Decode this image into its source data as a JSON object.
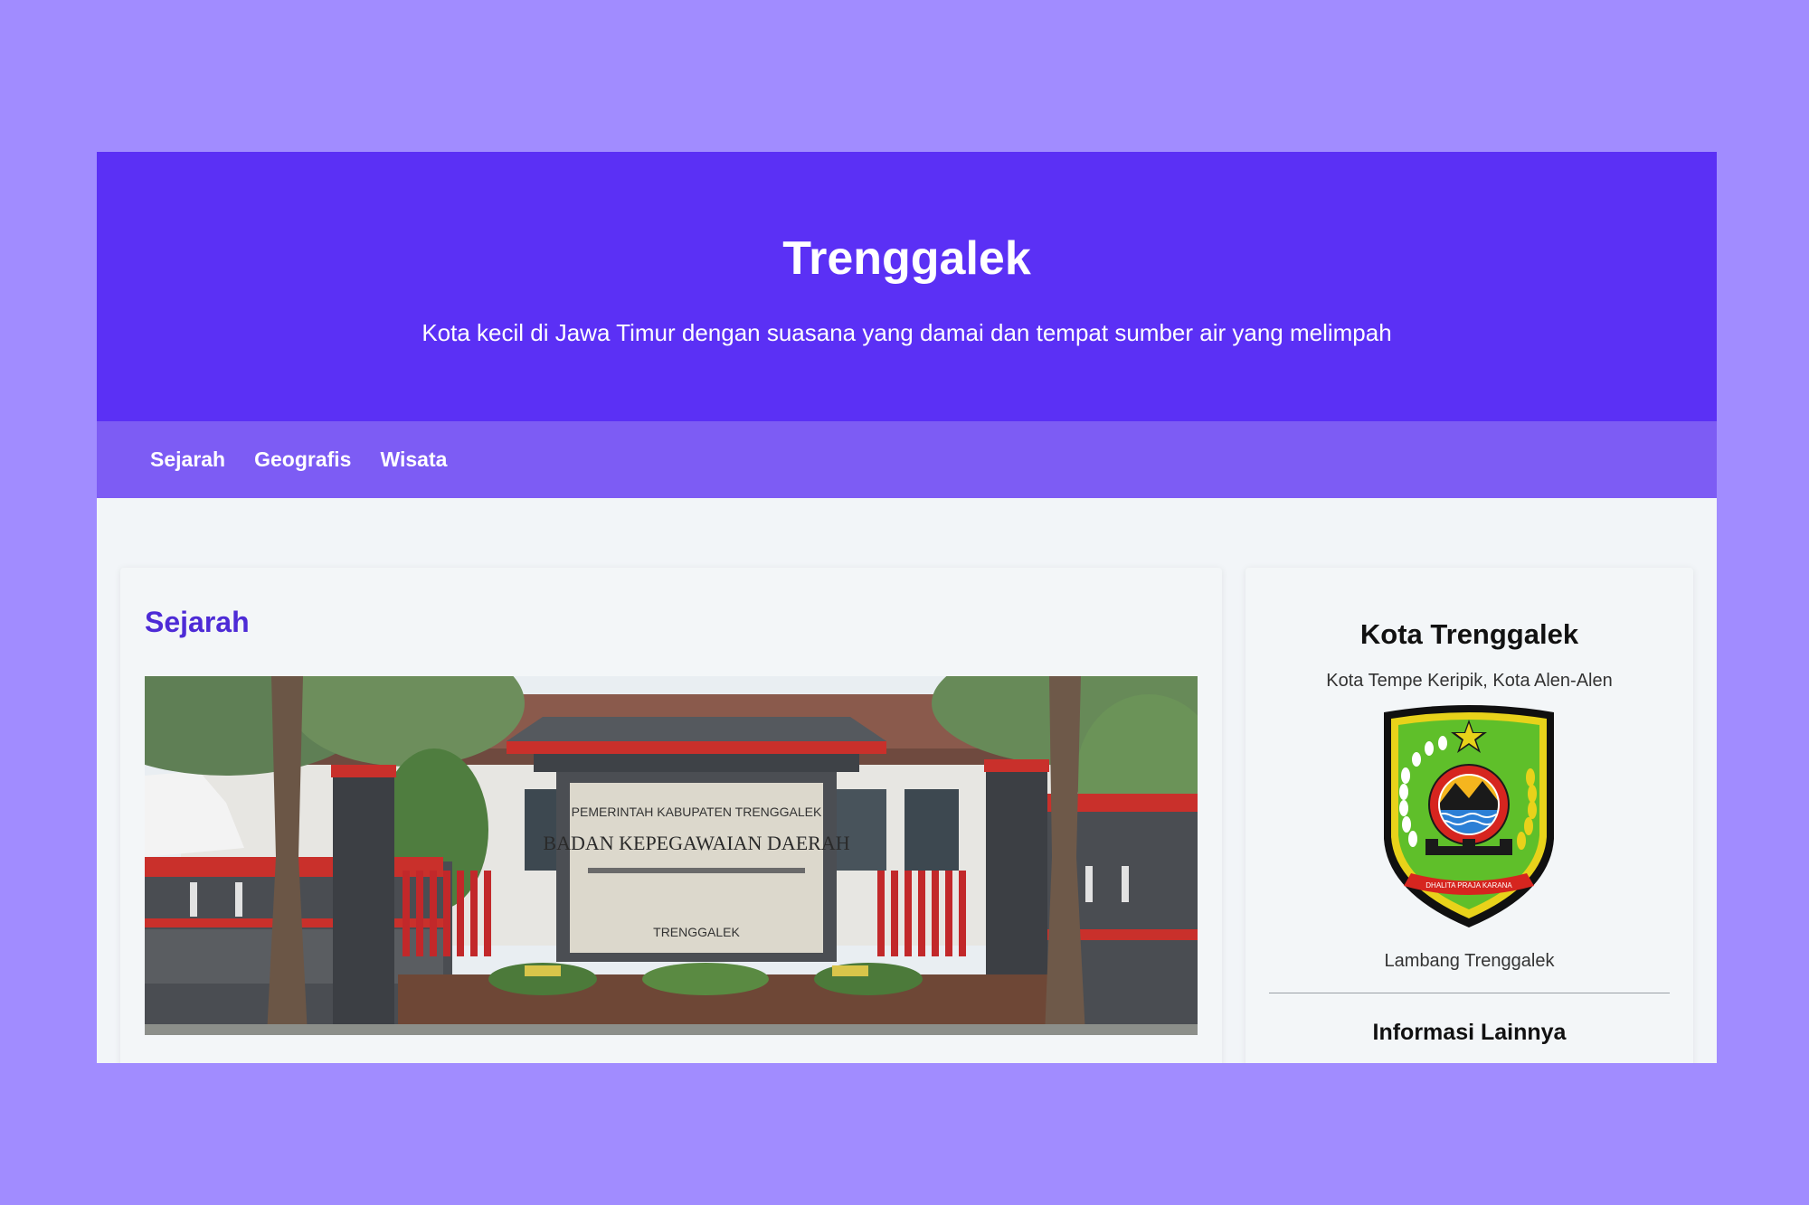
{
  "header": {
    "title": "Trenggalek",
    "subtitle": "Kota kecil di Jawa Timur dengan suasana yang damai dan tempat sumber air yang melimpah"
  },
  "nav": {
    "items": [
      "Sejarah",
      "Geografis",
      "Wisata"
    ]
  },
  "main": {
    "section_title": "Sejarah",
    "photo": {
      "sign_line1": "PEMERINTAH KABUPATEN TRENGGALEK",
      "sign_line2": "BADAN KEPEGAWAIAN DAERAH",
      "sign_line4": "TRENGGALEK"
    }
  },
  "sidebar": {
    "title": "Kota Trenggalek",
    "tagline": "Kota Tempe Keripik, Kota Alen-Alen",
    "emblem_caption": "Lambang Trenggalek",
    "emblem_ribbon": "DHALITA PRAJA KARANA",
    "more_info_heading": "Informasi Lainnya"
  },
  "colors": {
    "background": "#a18cff",
    "header_bg": "#5b30f5",
    "nav_bg": "#7d5cf4",
    "section_title": "#4d2bd6"
  }
}
